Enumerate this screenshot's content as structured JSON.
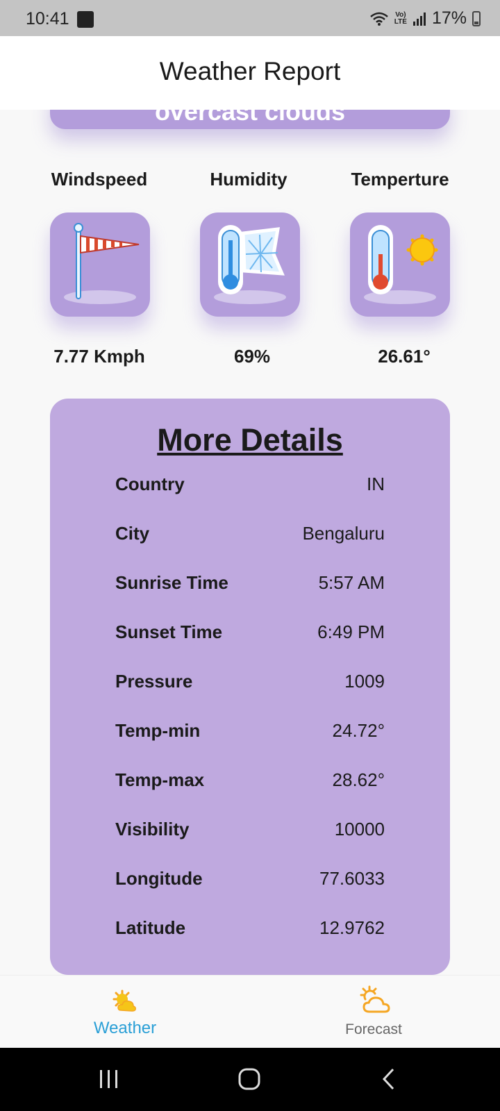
{
  "status_bar": {
    "time": "10:41",
    "volte": "Vo)",
    "lte": "LTE",
    "battery": "17%"
  },
  "app_bar": {
    "title": "Weather Report"
  },
  "description": "overcast clouds",
  "metrics": [
    {
      "label": "Windspeed",
      "value": "7.77 Kmph",
      "icon": "windsock-icon"
    },
    {
      "label": "Humidity",
      "value": "69%",
      "icon": "thermometer-snowflake-icon"
    },
    {
      "label": "Temperture",
      "value": "26.61°",
      "icon": "thermometer-sun-icon"
    }
  ],
  "details": {
    "title": "More Details",
    "rows": [
      {
        "key": "Country",
        "value": "IN"
      },
      {
        "key": "City",
        "value": "Bengaluru"
      },
      {
        "key": "Sunrise Time",
        "value": "5:57 AM"
      },
      {
        "key": "Sunset Time",
        "value": "6:49 PM"
      },
      {
        "key": "Pressure",
        "value": "1009"
      },
      {
        "key": "Temp-min",
        "value": "24.72°"
      },
      {
        "key": "Temp-max",
        "value": "28.62°"
      },
      {
        "key": "Visibility",
        "value": "10000"
      },
      {
        "key": "Longitude",
        "value": "77.6033"
      },
      {
        "key": "Latitude",
        "value": "12.9762"
      }
    ]
  },
  "bottom_nav": {
    "items": [
      {
        "label": "Weather",
        "active": true
      },
      {
        "label": "Forecast",
        "active": false
      }
    ]
  },
  "colors": {
    "accent": "#b39ddb",
    "details_bg": "#bfa9df",
    "active_tab": "#2a9fd6",
    "icon_orange": "#f5a623"
  }
}
